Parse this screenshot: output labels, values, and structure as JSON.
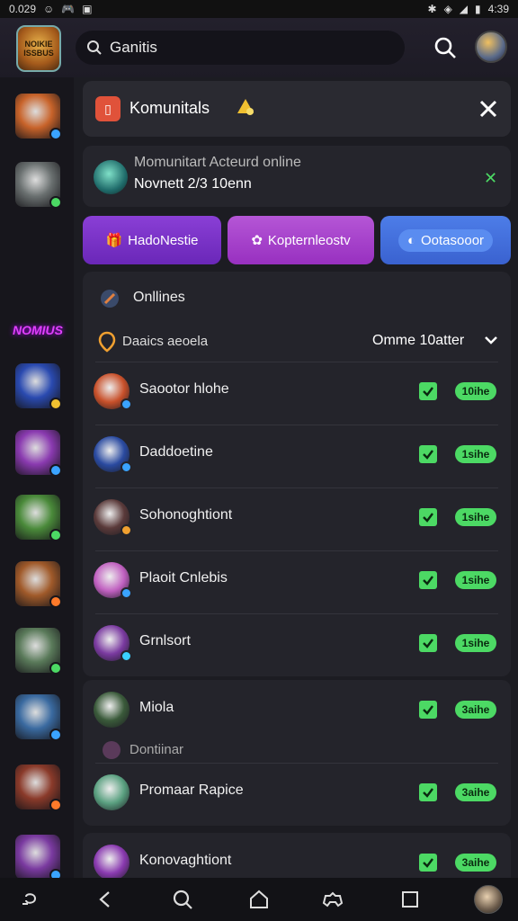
{
  "status_bar": {
    "time": "0.029",
    "clock": "4:39"
  },
  "app": {
    "logo_text": "NOIKIE ISSBUS"
  },
  "search": {
    "value": "Ganitis",
    "placeholder": ""
  },
  "sidebar": {
    "brand_text": "NOMIUS",
    "items": [
      {
        "name": "game-1",
        "color": "#c8632a",
        "dot": "#3aa3ff"
      },
      {
        "name": "game-2",
        "color": "#6a7070",
        "dot": "#4cd964"
      },
      {
        "name": "game-3",
        "color": "#7aa040",
        "dot": "#ff7a2a"
      },
      {
        "name": "game-4",
        "color": "#2a4ab0",
        "dot": "#f0c030"
      },
      {
        "name": "game-5",
        "color": "#8a3ab0",
        "dot": "#3aa3ff"
      },
      {
        "name": "game-6",
        "color": "#4a8a3a",
        "dot": "#4cd964"
      },
      {
        "name": "game-7",
        "color": "#a05a2a",
        "dot": "#ff7a2a"
      },
      {
        "name": "game-8",
        "color": "#5a7a5a",
        "dot": "#4cd964"
      },
      {
        "name": "game-9",
        "color": "#3a6aa0",
        "dot": "#3aa3ff"
      },
      {
        "name": "game-10",
        "color": "#8a3a2a",
        "dot": "#ff7a2a"
      },
      {
        "name": "game-11",
        "color": "#7a3aa0",
        "dot": "#3aa3ff"
      }
    ]
  },
  "header": {
    "title": "Komunitals"
  },
  "online_card": {
    "line1": "Momunitart Acteurd online",
    "line2": "Novnett 2/3 10enn"
  },
  "tabs": [
    {
      "label": "HadoNestie"
    },
    {
      "label": "Kopternleostv"
    },
    {
      "label": "Ootasooor"
    }
  ],
  "sections": {
    "online_label": "Onllines",
    "status_label": "Daaics aeoela",
    "filter_label": "Omme 10atter",
    "sub_label": "Dontiinar"
  },
  "rows": [
    {
      "name": "Saootor hlohe",
      "badge": "10ihe",
      "avatar": "#c8502a",
      "dot": "#3aa3ff"
    },
    {
      "name": "Daddoetine",
      "badge": "1sihe",
      "avatar": "#2a4aa0",
      "dot": "#3aa3ff"
    },
    {
      "name": "Sohonoghtiont",
      "badge": "1sihe",
      "avatar": "#5a3a3a",
      "dot": "#f0a030"
    },
    {
      "name": "Plaoit Cnlebis",
      "badge": "1sihe",
      "avatar": "#c060c0",
      "dot": "#3aa3ff"
    },
    {
      "name": "Grnlsort",
      "badge": "1sihe",
      "avatar": "#7a3aa0",
      "dot": "#3ad0ff"
    },
    {
      "name": "Miola",
      "badge": "3aihe",
      "avatar": "#3a5a3a",
      "dot": ""
    },
    {
      "name": "Promaar Rapice",
      "badge": "3aihe",
      "avatar": "#5aa080",
      "dot": ""
    },
    {
      "name": "Konovaghtiont",
      "badge": "3aihe",
      "avatar": "#8a3ab0",
      "dot": ""
    }
  ]
}
